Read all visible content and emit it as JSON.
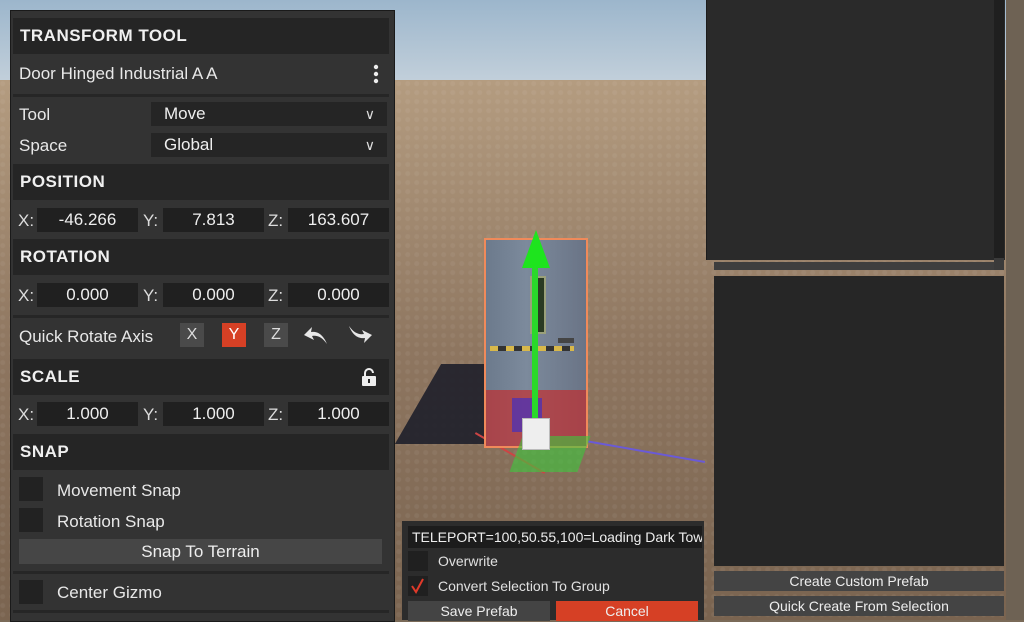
{
  "transform_tool": {
    "title": "TRANSFORM TOOL",
    "object_name": "Door Hinged Industrial A A",
    "tool_label": "Tool",
    "tool_value": "Move",
    "space_label": "Space",
    "space_value": "Global",
    "position": {
      "title": "POSITION",
      "x_label": "X:",
      "x": "-46.266",
      "y_label": "Y:",
      "y": "7.813",
      "z_label": "Z:",
      "z": "163.607"
    },
    "rotation": {
      "title": "ROTATION",
      "x_label": "X:",
      "x": "0.000",
      "y_label": "Y:",
      "y": "0.000",
      "z_label": "Z:",
      "z": "0.000"
    },
    "quick_rotate": {
      "label": "Quick Rotate Axis",
      "axes": [
        "X",
        "Y",
        "Z"
      ],
      "active_axis": "Y"
    },
    "scale": {
      "title": "SCALE",
      "x_label": "X:",
      "x": "1.000",
      "y_label": "Y:",
      "y": "1.000",
      "z_label": "Z:",
      "z": "1.000"
    },
    "snap": {
      "title": "SNAP",
      "movement_snap": "Movement Snap",
      "rotation_snap": "Rotation Snap",
      "snap_to_terrain": "Snap To Terrain"
    },
    "center_gizmo": "Center Gizmo"
  },
  "prefab_dialog": {
    "input_value": "TELEPORT=100,50.55,100=Loading Dark Tow",
    "overwrite": "Overwrite",
    "convert_selection": "Convert Selection To Group",
    "convert_checked": true,
    "save_prefab": "Save Prefab",
    "cancel": "Cancel"
  },
  "right_panel": {
    "create_custom_prefab": "Create Custom Prefab",
    "quick_create": "Quick Create From Selection"
  },
  "colors": {
    "active_red": "#d64025",
    "panel_bg": "#333333",
    "header_bg": "#252525",
    "gizmo_green": "#1ee41e"
  },
  "icons": {
    "menu": "kebab-menu-icon",
    "lock": "unlock-icon",
    "rotate_left": "rotate-left-icon",
    "rotate_right": "rotate-right-icon",
    "checkmark": "checkmark-icon",
    "chevron": "chevron-down-icon"
  }
}
